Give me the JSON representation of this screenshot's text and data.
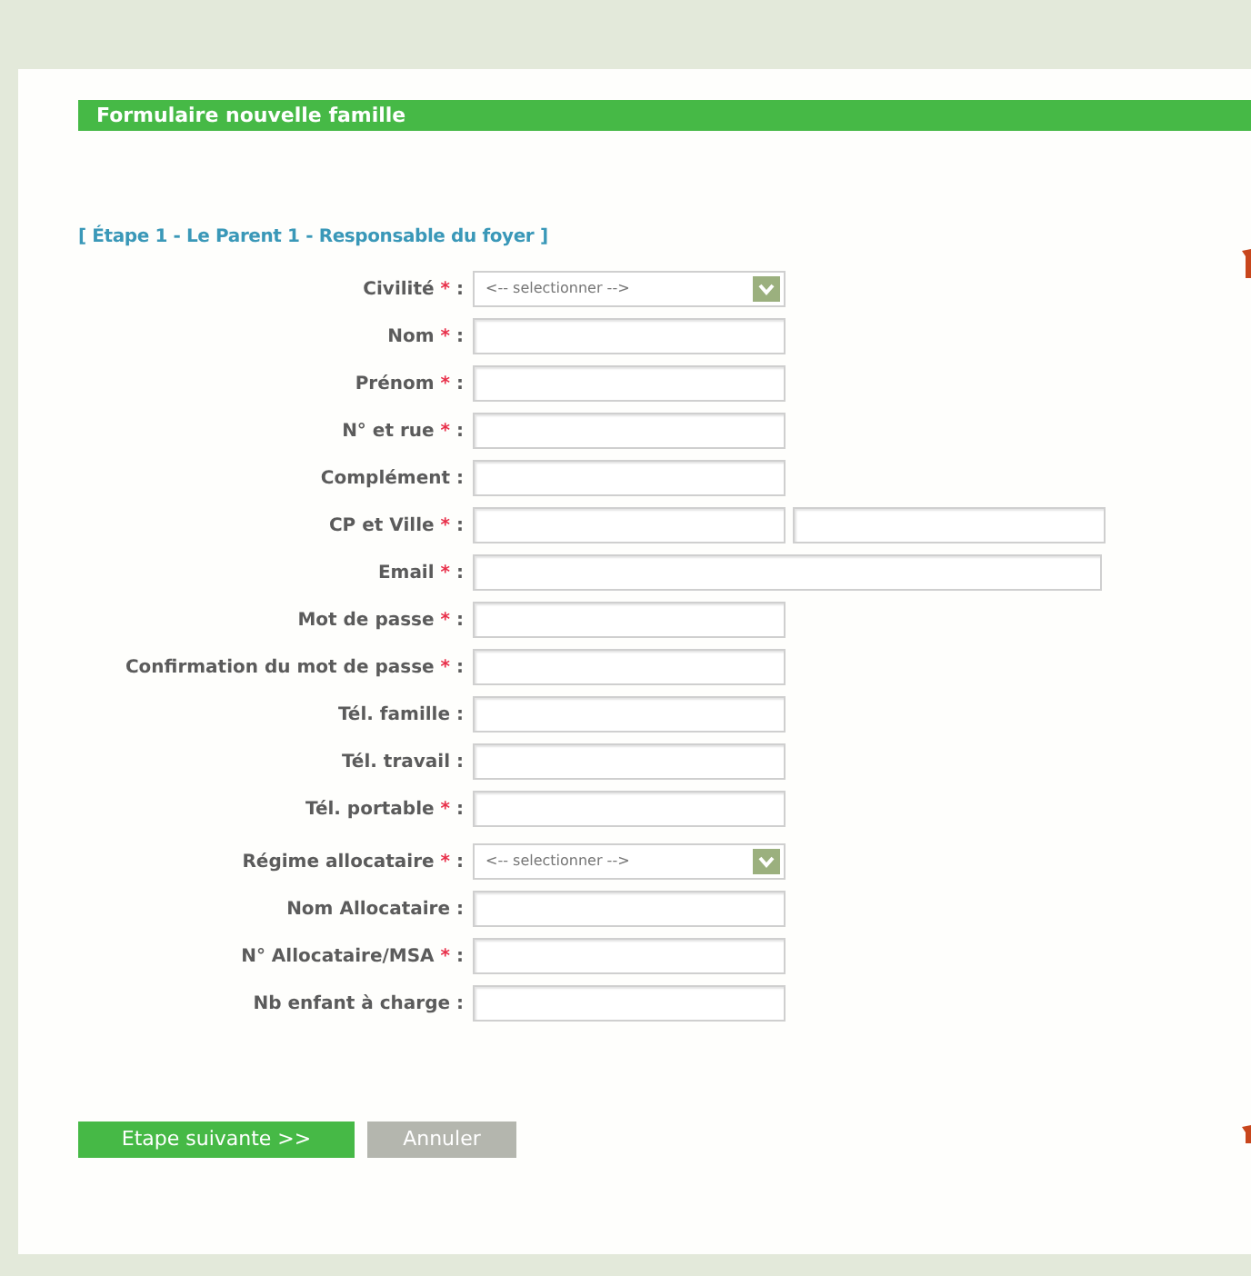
{
  "header": {
    "title": "Formulaire nouvelle famille"
  },
  "step_title": "[ Étape 1 - Le Parent 1 - Responsable du foyer ]",
  "sections": [
    {
      "fields": [
        {
          "kind": "select",
          "label": "Civilité",
          "required_mark": "*",
          "colon": ":",
          "value": "<-- selectionner -->"
        },
        {
          "kind": "text",
          "label": "Nom",
          "required_mark": "*",
          "colon": ":"
        },
        {
          "kind": "text",
          "label": "Prénom",
          "required_mark": "*",
          "colon": ":"
        },
        {
          "kind": "text",
          "label": "N° et rue",
          "required_mark": "*",
          "colon": ":"
        },
        {
          "kind": "text",
          "label": "Complément",
          "colon": ":"
        },
        {
          "kind": "pair",
          "label": "CP et Ville",
          "required_mark": "*",
          "colon": ":"
        },
        {
          "kind": "wide",
          "label": "Email",
          "required_mark": "*",
          "colon": ":"
        },
        {
          "kind": "text",
          "label": "Mot de passe",
          "required_mark": "*",
          "colon": ":"
        },
        {
          "kind": "text",
          "label": "Confirmation du mot de passe",
          "required_mark": "*",
          "colon": ":"
        },
        {
          "kind": "text",
          "label": "Tél. famille",
          "colon": ":"
        },
        {
          "kind": "text",
          "label": "Tél. travail",
          "colon": ":"
        },
        {
          "kind": "text",
          "label": "Tél. portable",
          "required_mark": "*",
          "colon": ":"
        }
      ]
    },
    {
      "fields": [
        {
          "kind": "select",
          "label": "Régime allocataire",
          "required_mark": "*",
          "colon": ":",
          "value": "<-- selectionner -->"
        },
        {
          "kind": "text",
          "label": "Nom Allocataire",
          "colon": ":"
        },
        {
          "kind": "text",
          "label": "N° Allocataire/MSA",
          "required_mark": "*",
          "colon": ":"
        },
        {
          "kind": "text",
          "label": "Nb enfant à charge",
          "colon": ":"
        }
      ]
    }
  ],
  "buttons": [
    {
      "kind": "primary",
      "label": "Etape suivante >>"
    },
    {
      "kind": "secondary",
      "label": "Annuler"
    }
  ]
}
